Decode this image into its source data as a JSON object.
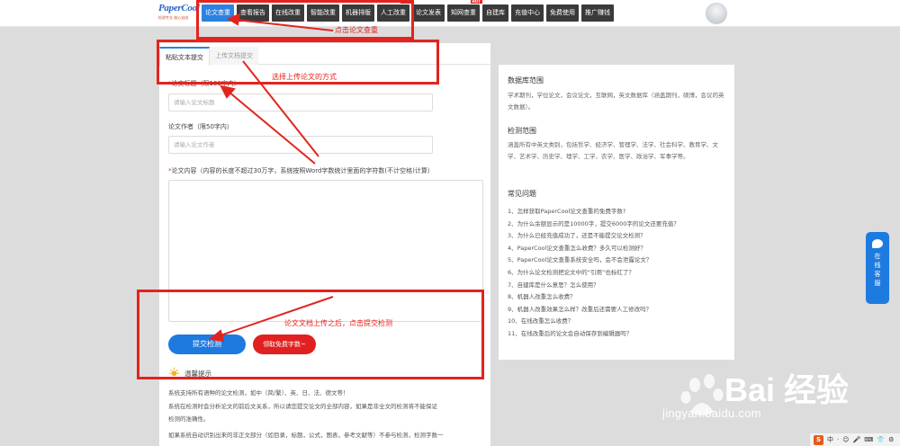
{
  "logo": {
    "main": "PaperCool",
    "sub": "检测专业 放心自由"
  },
  "nav": [
    {
      "label": "论文查重",
      "active": true,
      "hot": ""
    },
    {
      "label": "查看报告",
      "active": false,
      "hot": ""
    },
    {
      "label": "在线改重",
      "active": false,
      "hot": ""
    },
    {
      "label": "智能改重",
      "active": false,
      "hot": ""
    },
    {
      "label": "机器排版",
      "active": false,
      "hot": ""
    },
    {
      "label": "人工改重",
      "active": false,
      "hot": "HOT"
    },
    {
      "label": "论文发表",
      "active": false,
      "hot": ""
    },
    {
      "label": "知网查重",
      "active": false,
      "hot": "HOT"
    },
    {
      "label": "自建库",
      "active": false,
      "hot": ""
    },
    {
      "label": "充值中心",
      "active": false,
      "hot": ""
    },
    {
      "label": "免费使用",
      "active": false,
      "hot": ""
    },
    {
      "label": "推广赚钱",
      "active": false,
      "hot": ""
    }
  ],
  "tabs": {
    "paste": "粘贴文本提交",
    "upload": "上传文档提交"
  },
  "form": {
    "title_label": "论文标题（限100字内）",
    "title_placeholder": "请输入论文标题",
    "author_label": "论文作者（限50字内）",
    "author_placeholder": "请输入论文作者",
    "content_label": "论文内容（内容的长度不超过30万字，系统按照Word字数统计里面的字符数(不计空格)计算）",
    "required_mark": "*"
  },
  "buttons": {
    "submit": "提交检测",
    "free": "领取免费字数~"
  },
  "tips": {
    "title": "温馨提示",
    "lines": [
      "系统支持所有语种的论文检测，如中（简/繁）、英、日、法、德文等！",
      "系统在检测时会分析论文的前后文关系，所以请您提交论文的全部内容，如果是非全文的检测将不能保证",
      "检测的准确性。",
      "如果系统自动识别出来的非正文部分（如目录，标题，公式，图表，参考文献等）不参与检测，检测字数一"
    ]
  },
  "sidebar": {
    "db_title": "数据库范围",
    "db_text": "学术期刊，学位论文，会议论文，互联网，英文数据库（涵盖期刊，硕博，会议的英文数据）。",
    "scope_title": "检测范围",
    "scope_text": "涵盖所有中英文类别，包括哲学、经济学、管理学、法学、社会科学、教育学、文学、艺术学、历史学、理学、工学、农学、医学、政治学、军事学等。",
    "faq_title": "常见问题",
    "faq": [
      "1、怎样获取PaperCool论文查重的免费字数?",
      "2、为什么余额显示的是10000字，提交6000字的论文还要充值？",
      "3、为什么已经充值成功了，还是不能提交论文检测？",
      "4、PaperCool论文查重怎么收费？多久可以检测好？",
      "5、PaperCool论文查重系统安全吗，会不会泄露论文？",
      "6、为什么论文检测把论文中的“引用”也标红了？",
      "7、自建库是什么意思？怎么使用？",
      "8、机器人改重怎么收费？",
      "9、机器人改重效果怎么样？改重后还需要人工修改吗？",
      "10、在线改重怎么收费？",
      "11、在线改重后的论文会自动保存到编辑器吗？"
    ]
  },
  "service": {
    "label": "在线客服"
  },
  "annotations": {
    "click_check": "点击论文查重",
    "choose_upload": "选择上传论文的方式",
    "after_upload": "论文文档上传之后，点击提交检测"
  },
  "watermark": {
    "main": "Bai 经验",
    "sub": "jingyan.baidu.com"
  },
  "ime": {
    "items": [
      "S",
      "中",
      "·",
      "☺",
      "🎤",
      "⌨",
      "👕",
      "⚙"
    ]
  },
  "colors": {
    "accent": "#2c82e0",
    "annotation": "#e3241e",
    "free_button": "#e12121"
  }
}
